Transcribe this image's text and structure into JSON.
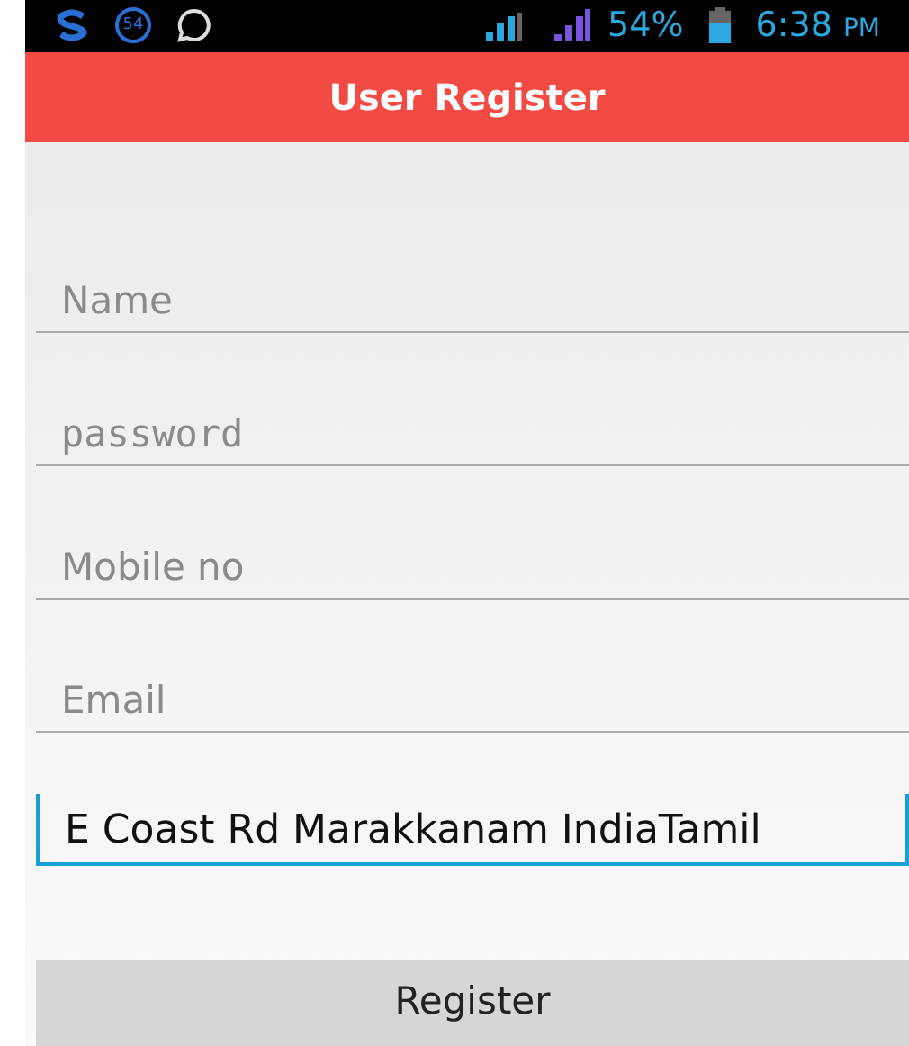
{
  "status_bar": {
    "notification_count": "54",
    "battery": "54%",
    "time": "6:38",
    "meridiem": "PM"
  },
  "app_bar": {
    "title": "User Register"
  },
  "fields": [
    {
      "kind": "text",
      "placeholder": "Name",
      "focused": false
    },
    {
      "kind": "password",
      "placeholder": "password",
      "focused": false
    },
    {
      "kind": "text",
      "placeholder": "Mobile no",
      "focused": false
    },
    {
      "kind": "text",
      "placeholder": "Email",
      "focused": false
    },
    {
      "kind": "text",
      "value": "E Coast Rd Marakkanam IndiaTamil",
      "focused": true
    }
  ],
  "button": {
    "label": "Register"
  }
}
